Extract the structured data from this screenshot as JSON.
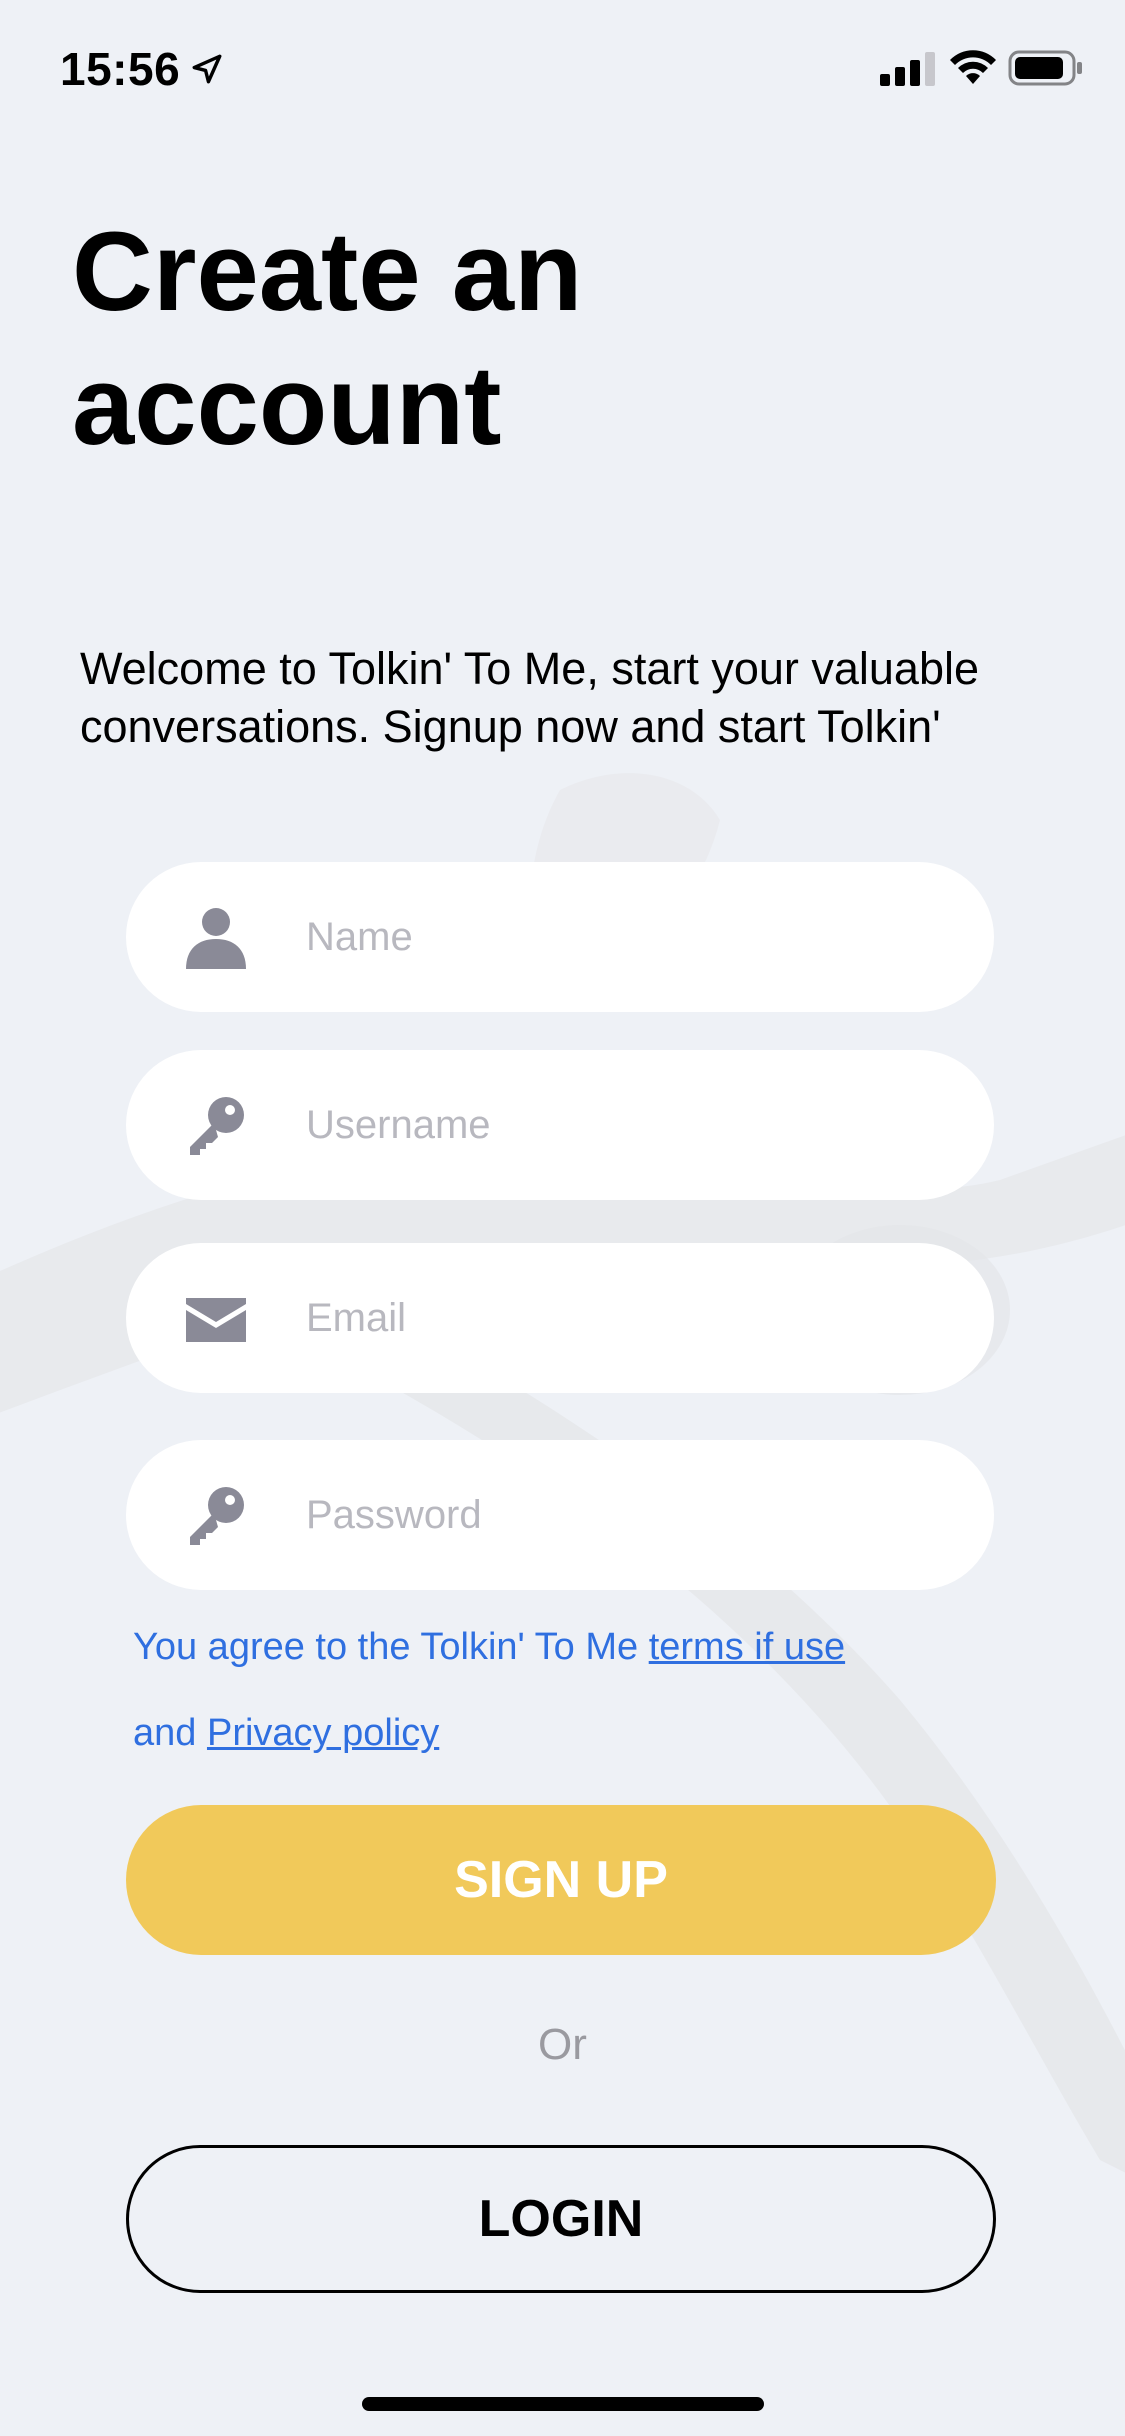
{
  "status_bar": {
    "time": "15:56",
    "icons": [
      "location-arrow-icon",
      "cellular-signal-icon",
      "wifi-icon",
      "battery-icon"
    ]
  },
  "header": {
    "title_line1": "Create an",
    "title_line2": "account"
  },
  "intro": {
    "line1": "Welcome to Tolkin' To Me, start your valuable",
    "line2": "conversations. Signup now and start Tolkin'"
  },
  "form": {
    "name": {
      "placeholder": "Name",
      "value": "",
      "icon": "person-icon"
    },
    "username": {
      "placeholder": "Username",
      "value": "",
      "icon": "key-icon"
    },
    "email": {
      "placeholder": "Email",
      "value": "",
      "icon": "envelope-icon"
    },
    "password": {
      "placeholder": "Password",
      "value": "",
      "icon": "key-icon"
    }
  },
  "agreement": {
    "prefix": "You agree to the Tolkin' To Me ",
    "terms_link": "terms if use",
    "and_text": "and ",
    "privacy_link": "Privacy policy"
  },
  "actions": {
    "signup_label": "SIGN UP",
    "or_text": "Or",
    "login_label": "LOGIN"
  },
  "colors": {
    "background": "#eef1f6",
    "field_bg": "#ffffff",
    "icon": "#8a8a97",
    "placeholder": "#b8b8bf",
    "link": "#2f6fe0",
    "signup_bg": "#f1c95a",
    "signup_text": "#ffffff",
    "or_text": "#9a9aa0"
  }
}
